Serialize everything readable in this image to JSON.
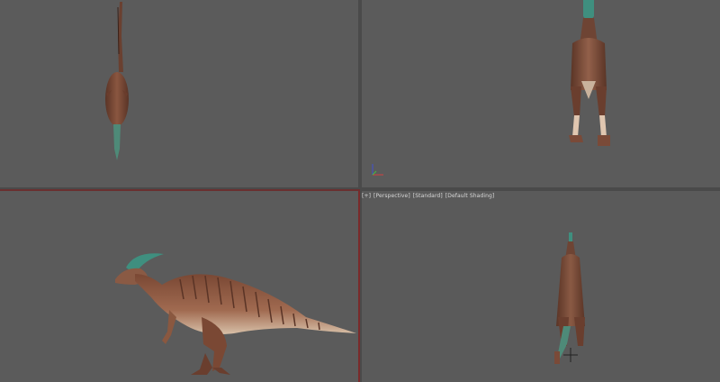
{
  "viewport_menu": {
    "plus": "[+]",
    "view": "[Perspective]",
    "shading_mode": "[Standard]",
    "shading": "[Default Shading]"
  },
  "colors": {
    "viewport_bg": "#5b5b5b",
    "active_border": "#7a2a2a",
    "dino_body": "#7a4a38",
    "crest": "#3f8f7f"
  },
  "icons": {
    "axis_gizmo": "axis-tripod-icon",
    "cursor": "crosshair-cursor-icon"
  }
}
